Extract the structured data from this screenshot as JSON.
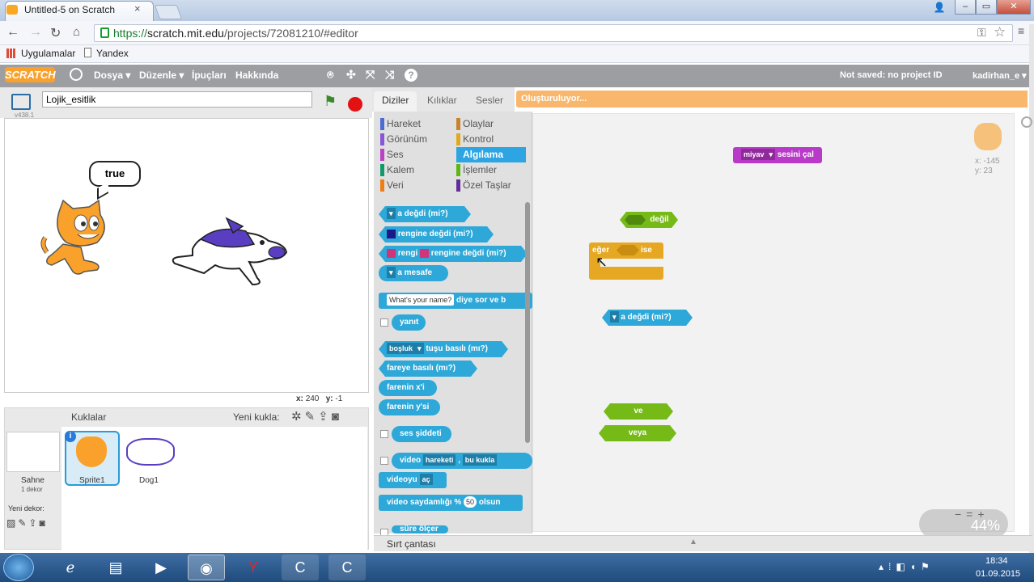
{
  "browser": {
    "tab_title": "Untitled-5 on Scratch",
    "url_scheme": "https://",
    "url_host": "scratch.mit.edu",
    "url_path": "/projects/72081210/#editor",
    "bookmarks": [
      "Uygulamalar",
      "Yandex"
    ]
  },
  "menu": {
    "logo": "SCRATCH",
    "items": [
      "Dosya ▾",
      "Düzenle ▾",
      "İpuçları",
      "Hakkında"
    ],
    "save_status": "Not saved: no project ID",
    "user": "kadirhan_e ▾"
  },
  "stage": {
    "sprite_name": "Lojik_esitlik",
    "version": "v438.1",
    "bubble": "true",
    "coords_x_label": "x:",
    "coords_x": "240",
    "coords_y_label": "y:",
    "coords_y": "-1"
  },
  "sprites": {
    "title": "Kuklalar",
    "new_sprite": "Yeni kukla:",
    "stage_label": "Sahne",
    "stage_sub": "1 dekor",
    "new_backdrop": "Yeni dekor:",
    "items": [
      "Sprite1",
      "Dog1"
    ]
  },
  "palette": {
    "tabs": [
      "Diziler",
      "Kılıklar",
      "Sesler"
    ],
    "categories_left": [
      "Hareket",
      "Görünüm",
      "Ses",
      "Kalem",
      "Veri"
    ],
    "categories_right": [
      "Olaylar",
      "Kontrol",
      "Algılama",
      "İşlemler",
      "Özel Taşlar"
    ],
    "cat_colors_left": [
      "#4a6cd4",
      "#8a55d7",
      "#bb42c3",
      "#0e9a6c",
      "#ee7d16"
    ],
    "cat_colors_right": [
      "#c88330",
      "#e1a91a",
      "#2ca5e2",
      "#5cb712",
      "#632d99"
    ],
    "blocks": {
      "touching": "a değdi (mi?)",
      "touching_color": "rengine değdi (mi?)",
      "color_touch_a": "rengi",
      "color_touch_b": "rengine değdi (mi?)",
      "distance": "a mesafe",
      "ask_default": "What's your name?",
      "ask": "diye sor ve b",
      "answer": "yanıt",
      "key_value": "boşluk",
      "key": "tuşu basılı (mı?)",
      "mouse_down": "fareye basılı (mı?)",
      "mouse_x": "farenin x'i",
      "mouse_y": "farenin y'si",
      "loudness": "ses şiddeti",
      "video_a": "video",
      "video_b": "hareketi",
      "video_c": "bu kukla",
      "video_on": "videoyu",
      "video_on_value": "aç",
      "video_transp": "video saydamlığı %",
      "video_transp_value": "50",
      "video_transp_end": "olsun",
      "timer": "süre ölçer"
    }
  },
  "scripts": {
    "status": "Oluşturuluyor...",
    "sound_block_dd": "miyav",
    "sound_block": "sesini çal",
    "not_block": "değil",
    "if_a": "eğer",
    "if_b": "ise",
    "touching_block": "a değdi (mi?)",
    "and_block": "ve",
    "or_block": "veya",
    "sprite_x": "x: -145",
    "sprite_y": "y: 23",
    "zoom_text": "44%",
    "backpack": "Sırt çantası"
  },
  "taskbar": {
    "time": "18:34",
    "date": "01.09.2015"
  }
}
